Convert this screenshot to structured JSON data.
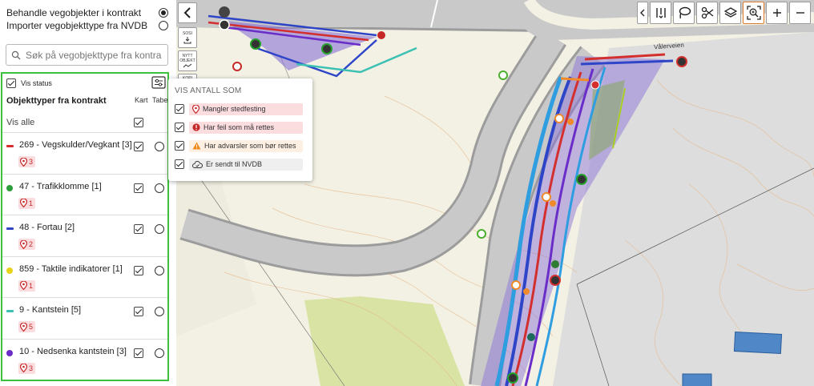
{
  "mode": {
    "options": [
      {
        "label": "Behandle vegobjekter i kontrakt",
        "selected": true
      },
      {
        "label": "Importer vegobjekttype fra NVDB",
        "selected": false
      }
    ]
  },
  "search": {
    "placeholder": "Søk på vegobjekttype fra kontrakt"
  },
  "types_panel": {
    "vis_status_label": "Vis status",
    "vis_status_checked": true,
    "heading": "Objekttyper fra kontrakt",
    "col_map": "Kart",
    "col_table": "Tabell",
    "show_all_label": "Vis alle",
    "show_all_checked": true,
    "items": [
      {
        "label": "269 - Vegskulder/Vegkant [3]",
        "color": "#d32f2f",
        "shape": "bar",
        "count": "3",
        "checked": true
      },
      {
        "label": "47 - Trafikklomme [1]",
        "color": "#2e9e3a",
        "shape": "dot",
        "count": "1",
        "checked": true
      },
      {
        "label": "48 - Fortau [2]",
        "color": "#2f45c8",
        "shape": "bar",
        "count": "2",
        "checked": true
      },
      {
        "label": "859 - Taktile indikatorer [1]",
        "color": "#e8d21a",
        "shape": "dot",
        "count": "1",
        "checked": true
      },
      {
        "label": "9 - Kantstein [5]",
        "color": "#3cc0b4",
        "shape": "bar",
        "count": "5",
        "checked": true
      },
      {
        "label": "10 - Nedsenka kantstein [3]",
        "color": "#6a2dc8",
        "shape": "dot",
        "count": "3",
        "checked": true
      }
    ]
  },
  "map_tools": {
    "back_icon": "chevron-left-icon",
    "sosi_label": "SOSI",
    "nytt_objekt_label": "NYTT OBJEKT",
    "kopi_label": "KOPI"
  },
  "toolbar": {
    "buttons": [
      "chevron-left-icon",
      "split-icon",
      "lasso-icon",
      "scissors-icon",
      "layers-icon",
      "zoom-select-icon",
      "plus-icon",
      "minus-icon"
    ]
  },
  "map": {
    "road_label": "Vålerveien"
  },
  "status_popup": {
    "title": "VIS ANTALL SOM",
    "rows": [
      {
        "label": "Mangler stedfesting",
        "checked": true,
        "tone": "red",
        "icon": "pin-icon"
      },
      {
        "label": "Har feil som må rettes",
        "checked": true,
        "tone": "red",
        "icon": "error-icon"
      },
      {
        "label": "Har advarsler som bør rettes",
        "checked": true,
        "tone": "orange",
        "icon": "warning-icon"
      },
      {
        "label": "Er sendt til NVDB",
        "checked": true,
        "tone": "grey",
        "icon": "cloud-icon"
      }
    ]
  },
  "colors": {
    "panel_border": "#3cc13c",
    "active_tool": "#e07b2c",
    "error": "#d32f2f"
  }
}
